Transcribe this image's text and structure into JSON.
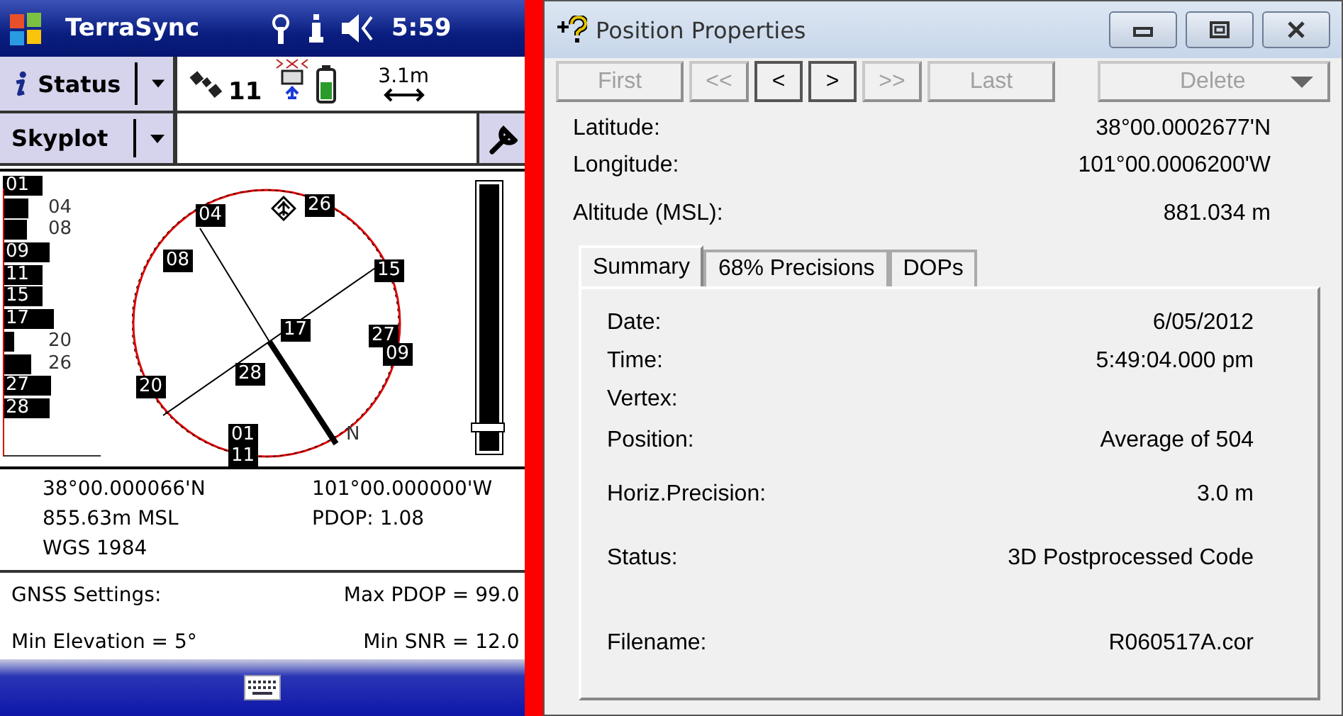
{
  "phone": {
    "title": "TerraSync",
    "clock": "5:59",
    "status_menu": {
      "label": "Status"
    },
    "satellite_count": "11",
    "accuracy": "3.1m",
    "view_menu": {
      "label": "Skyplot"
    },
    "snr_bars": [
      {
        "label": "01",
        "level": 0.7
      },
      {
        "label": "04",
        "level": 0.45
      },
      {
        "label": "08",
        "level": 0.42
      },
      {
        "label": "09",
        "level": 0.82
      },
      {
        "label": "11",
        "level": 0.7
      },
      {
        "label": "15",
        "level": 0.7
      },
      {
        "label": "17",
        "level": 0.9
      },
      {
        "label": "20",
        "level": 0.2
      },
      {
        "label": "26",
        "level": 0.5
      },
      {
        "label": "27",
        "level": 0.85
      },
      {
        "label": "28",
        "level": 0.82
      }
    ],
    "skyplot_satellites": [
      {
        "label": "04"
      },
      {
        "label": "26"
      },
      {
        "label": "08"
      },
      {
        "label": "15"
      },
      {
        "label": "17"
      },
      {
        "label": "27"
      },
      {
        "label": "09"
      },
      {
        "label": "28"
      },
      {
        "label": "20"
      },
      {
        "label": "01"
      },
      {
        "label": "11"
      }
    ],
    "north_label": "N",
    "gauge": {
      "level": 0.07
    },
    "position": {
      "latitude": "38°00.000066'N",
      "longitude": "101°00.000000'W",
      "altitude": "855.63m MSL",
      "pdop": "PDOP: 1.08",
      "datum": "WGS 1984"
    },
    "gnss_settings": {
      "heading": "GNSS Settings:",
      "max_pdop": "Max PDOP = 99.0",
      "min_elevation": "Min Elevation = 5°",
      "min_snr": "Min SNR = 12.0"
    }
  },
  "window": {
    "title": "Position Properties",
    "nav_buttons": [
      {
        "label": "First",
        "disabled": true
      },
      {
        "label": "<<",
        "disabled": true
      },
      {
        "label": "<",
        "disabled": false
      },
      {
        "label": ">",
        "disabled": false
      },
      {
        "label": ">>",
        "disabled": true
      },
      {
        "label": "Last",
        "disabled": true
      }
    ],
    "delete_button": {
      "label": "Delete",
      "disabled": true
    },
    "fields": [
      {
        "label": "Latitude:",
        "value": "38°00.0002677'N"
      },
      {
        "label": "Longitude:",
        "value": "101°00.0006200'W"
      },
      {
        "label": "Altitude (MSL):",
        "value": "881.034 m"
      }
    ],
    "tabs": [
      {
        "label": "Summary",
        "selected": true
      },
      {
        "label": "68% Precisions",
        "selected": false
      },
      {
        "label": "DOPs",
        "selected": false
      }
    ],
    "summary": [
      {
        "label": "Date:",
        "value": "6/05/2012"
      },
      {
        "label": "Time:",
        "value": "5:49:04.000 pm"
      },
      {
        "label": "Vertex:"
      },
      {
        "label": "Position:",
        "value": "Average of 504"
      },
      {
        "label": "Horiz.Precision:",
        "value": "3.0 m"
      },
      {
        "label": "Status:",
        "value": "3D Postprocessed Code"
      },
      {
        "label": "Filename:",
        "value": "R060517A.cor"
      }
    ]
  }
}
